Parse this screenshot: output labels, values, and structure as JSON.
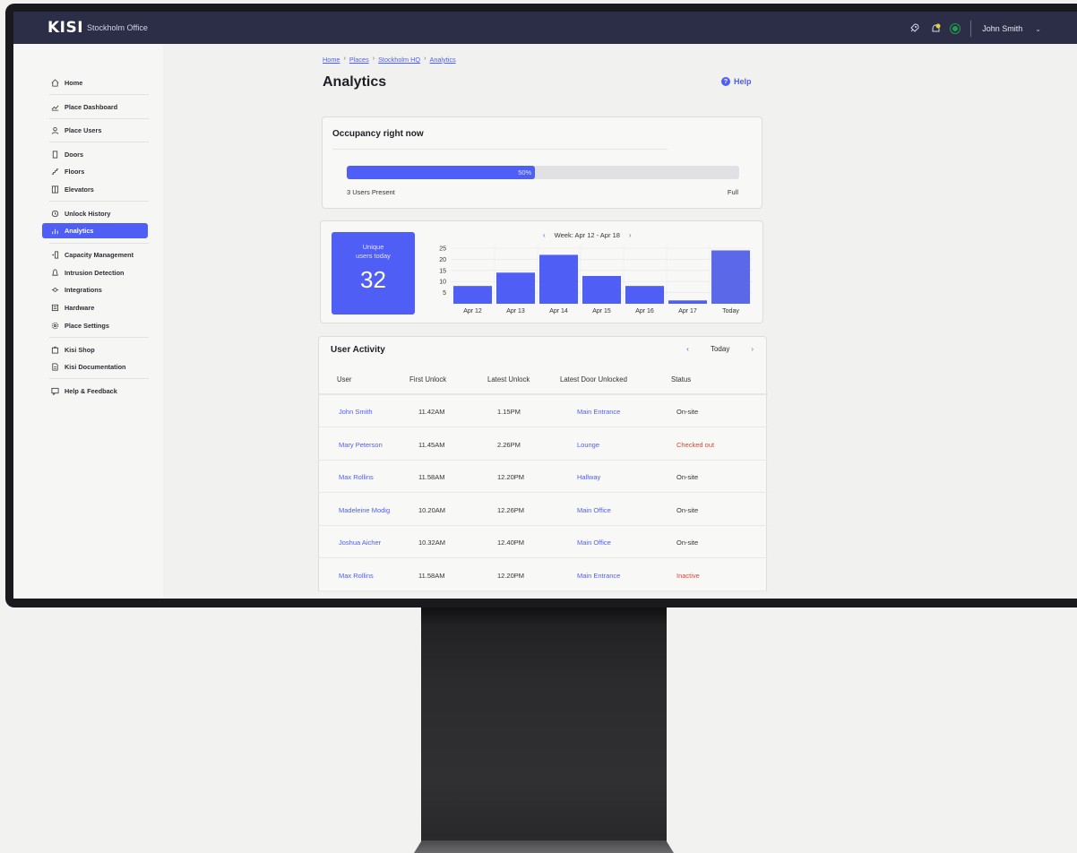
{
  "topbar": {
    "logo": "kisi",
    "office": "Stockholm Office",
    "user": "John Smith",
    "icons": [
      "rocket-icon",
      "notification-bell-icon",
      "online-status-icon",
      "chevron-down-icon"
    ],
    "status_color": "#1e9e4a"
  },
  "sidebar": {
    "items": [
      {
        "label": "Home",
        "icon": "home-icon"
      },
      {
        "label": "Place Dashboard",
        "icon": "dashboard-icon"
      },
      {
        "label": "Place Users",
        "icon": "user-icon"
      },
      {
        "label": "Doors",
        "icon": "door-icon"
      },
      {
        "label": "Floors",
        "icon": "floors-icon"
      },
      {
        "label": "Elevators",
        "icon": "elevator-icon"
      },
      {
        "label": "Unlock History",
        "icon": "history-icon"
      },
      {
        "label": "Analytics",
        "icon": "analytics-icon",
        "active": true
      },
      {
        "label": "Capacity Management",
        "icon": "capacity-icon"
      },
      {
        "label": "Intrusion Detection",
        "icon": "intrusion-icon"
      },
      {
        "label": "Integrations",
        "icon": "integrations-icon"
      },
      {
        "label": "Hardware",
        "icon": "hardware-icon"
      },
      {
        "label": "Place Settings",
        "icon": "settings-icon"
      },
      {
        "label": "Kisi Shop",
        "icon": "shop-icon"
      },
      {
        "label": "Kisi Documentation",
        "icon": "documentation-icon"
      },
      {
        "label": "Help & Feedback",
        "icon": "feedback-icon"
      }
    ]
  },
  "breadcrumb": [
    "Home",
    "Places",
    "Stockholm HQ",
    "Analytics"
  ],
  "page_title": "Analytics",
  "help_label": "Help",
  "occupancy": {
    "title": "Occupancy right now",
    "percent_label": "50%",
    "fill_fraction": 0.48,
    "users_present": "3 Users Present",
    "full_label": "Full"
  },
  "unique_users": {
    "label_line1": "Unique",
    "label_line2": "users today",
    "value": "32"
  },
  "week_label": "Week: Apr 12 - Apr 18",
  "accent_color": "#4f5ef5",
  "chart_data": {
    "type": "bar",
    "categories": [
      "Apr 12",
      "Apr 13",
      "Apr 14",
      "Apr 15",
      "Apr 16",
      "Apr 17",
      "Today"
    ],
    "values": [
      8,
      14,
      22,
      12.5,
      8,
      1.5,
      24
    ],
    "yticks": [
      5,
      10,
      15,
      20,
      25
    ],
    "ylim": [
      0,
      25
    ],
    "colors": [
      "#4f5ef5",
      "#4f5ef5",
      "#4f5ef5",
      "#4f5ef5",
      "#4f5ef5",
      "#4f5ef5",
      "#5b68e8"
    ]
  },
  "activity": {
    "title": "User Activity",
    "day_label": "Today",
    "columns": [
      "User",
      "First Unlock",
      "Latest Unlock",
      "Latest Door Unlocked",
      "Status"
    ],
    "rows": [
      {
        "user": "John Smith",
        "first": "11.42AM",
        "latest": "1.15PM",
        "door": "Main Entrance",
        "status": "On-site",
        "status_style": "normal"
      },
      {
        "user": "Mary Peterson",
        "first": "11.45AM",
        "latest": "2.26PM",
        "door": "Lounge",
        "status": "Checked out",
        "status_style": "red"
      },
      {
        "user": "Max Rollins",
        "first": "11.58AM",
        "latest": "12.20PM",
        "door": "Hallway",
        "status": "On-site",
        "status_style": "normal"
      },
      {
        "user": "Madeleine Modig",
        "first": "10.20AM",
        "latest": "12.26PM",
        "door": "Main Office",
        "status": "On-site",
        "status_style": "normal"
      },
      {
        "user": "Joshua Aicher",
        "first": "10.32AM",
        "latest": "12.40PM",
        "door": "Main Office",
        "status": "On-site",
        "status_style": "normal"
      },
      {
        "user": "Max Rollins",
        "first": "11.58AM",
        "latest": "12.20PM",
        "door": "Main Entrance",
        "status": "Inactive",
        "status_style": "red"
      }
    ]
  }
}
